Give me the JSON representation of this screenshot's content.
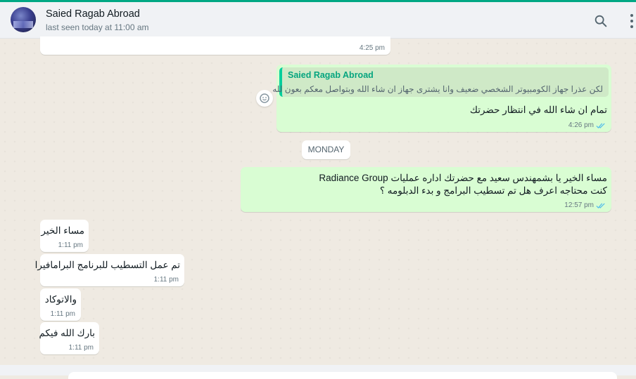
{
  "header": {
    "contact_name": "Saied Ragab Abroad",
    "last_seen": "last seen today at 11:00 am",
    "search_icon": "search-icon",
    "menu_icon": "more-vertical-icon"
  },
  "colors": {
    "accent": "#00a884",
    "incoming_bubble": "#ffffff",
    "outgoing_bubble": "#d9fdd3",
    "read_ticks": "#53bdeb",
    "quote_author": "#06a57f"
  },
  "messages": [
    {
      "direction": "in",
      "text": "",
      "time": "4:25 pm"
    },
    {
      "direction": "out",
      "quoted": {
        "author": "Saied Ragab Abroad",
        "text": "لكن عذرا جهاز الكومبيوتر الشخصي ضعيف وانا يشترى جهاز ان شاء الله وبتواصل معكم بعون لله"
      },
      "text": "تمام ان شاء الله في انتظار حضرتك",
      "time": "4:26 pm",
      "status": "read"
    },
    {
      "direction": "out",
      "lines": [
        "مساء الخير يا بشمهندس سعيد  مع حضرتك اداره عمليات Radiance Group",
        "كنت محتاجه اعرف هل تم تسطيب البرامج و بدء الدبلومه ؟"
      ],
      "time": "12:57 pm",
      "status": "read"
    },
    {
      "direction": "in",
      "text": "مساء الخير",
      "time": "1:11 pm"
    },
    {
      "direction": "in",
      "text": "تم عمل التسطيب للبرنامج البرامافيرا",
      "time": "1:11 pm"
    },
    {
      "direction": "in",
      "text": "والاتوكاد",
      "time": "1:11 pm"
    },
    {
      "direction": "in",
      "text": "بارك الله فيكم",
      "time": "1:11 pm"
    }
  ],
  "day_separator": "MONDAY"
}
